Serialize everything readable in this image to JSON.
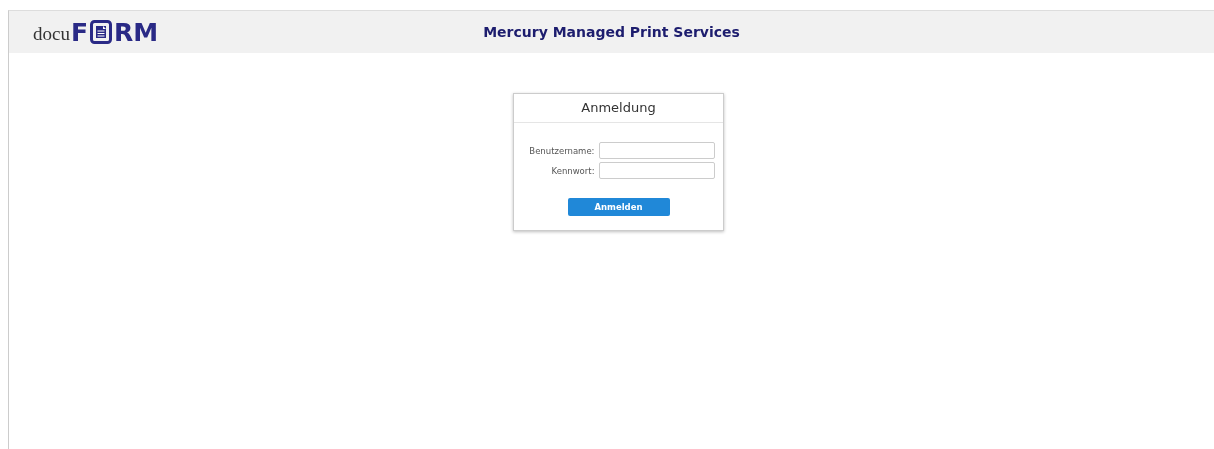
{
  "logo": {
    "prefix": "docu",
    "before_icon": "F",
    "after_icon": "RM"
  },
  "header": {
    "title": "Mercury Managed Print Services"
  },
  "login": {
    "title": "Anmeldung",
    "fields": [
      {
        "label": "Benutzername:"
      },
      {
        "label": "Kennwort:"
      }
    ],
    "button": "Anmelden"
  }
}
